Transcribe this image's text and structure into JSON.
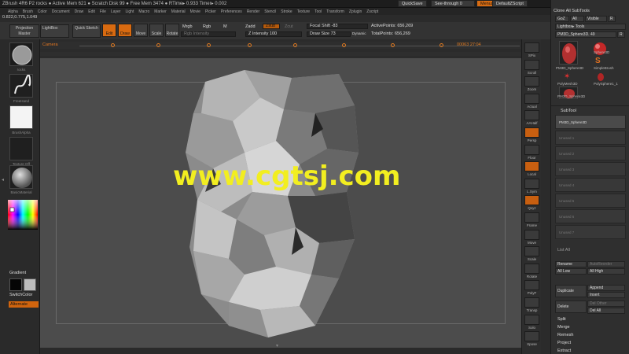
{
  "titlebar": {
    "text": "ZBrush 4R6 P2    rocks   ● Active Mem 621  ● Scratch Disk 99  ● Free Mem 3474  ● RTime▸ 0.933  Timer▸ 0.002",
    "quicksave": "QuickSave",
    "see_through": "See-through   0",
    "menus": "Menus",
    "script": "DefaultZScript"
  },
  "menubar": {
    "items": [
      "Alpha",
      "Brush",
      "Color",
      "Document",
      "Draw",
      "Edit",
      "File",
      "Layer",
      "Light",
      "Macro",
      "Marker",
      "Material",
      "Movie",
      "Picker",
      "Preferences",
      "Render",
      "Stencil",
      "Stroke",
      "Texture",
      "Tool",
      "Transform",
      "Zplugin",
      "Zscript"
    ]
  },
  "coords": "0.822,0.775,1.049",
  "shelf": {
    "projection_master": "Projection Master",
    "lightbox": "LightBox",
    "quick_sketch": "Quick Sketch",
    "edit": "Edit",
    "draw": "Draw",
    "move": "Move",
    "scale": "Scale",
    "rotate": "Rotate",
    "mrgb": "Mrgb",
    "rgb": "Rgb",
    "m": "M",
    "rgb_intensity": "Rgb Intensity",
    "zadd": "Zadd",
    "zsub": "Zsub",
    "zcut": "Zcut",
    "z_intensity": "Z Intensity 100",
    "focal_shift": "Focal Shift -83",
    "draw_size": "Draw Size 73",
    "dynamic": "Dynamic",
    "active_points": "ActivePoints: 656,269",
    "total_points": "TotalPoints: 656,269"
  },
  "camera": {
    "label": "Camera",
    "readout": "00063  27:04"
  },
  "left": {
    "brush_label": "rocks",
    "stroke_label": "FreeHand",
    "alpha_label": "BrushAlpha",
    "texture_label": "Texture Off",
    "material_label": "BasicMaterial",
    "gradient": "Gradient",
    "switch_color": "SwitchColor",
    "alternate": "Alternate"
  },
  "rightstrip": {
    "labels": [
      "SPix",
      "Scroll",
      "Zoom",
      "Actual",
      "AAHalf",
      "Persp",
      "Floor",
      "Local",
      "L.Sym",
      "Qxyz",
      "Frame",
      "Move",
      "Scale",
      "Rotate",
      "PolyF",
      "Transp",
      "Solo",
      "Xpose"
    ]
  },
  "toolpanel": {
    "header": "Clone  All  SubTools",
    "goz": "GoZ",
    "all": "All",
    "visible": "Visible",
    "r": "R",
    "lightbox_tools": "Lightbox▸ Tools",
    "current_tool": "PM3D_Sphere3D. 49",
    "r2": "R",
    "thumbs": [
      "PM3D_Sphere3D",
      "Sphere3D",
      "SimpleBrush",
      "PolyMesh3D",
      "PolySphere1_1",
      "PM3D_Sphere3D"
    ],
    "subtool_title": "SubTool",
    "subtool_active": "PM3D_Sphere3D",
    "subtool_slots": [
      "Unused 1",
      "Unused 2",
      "Unused 3",
      "Unused 4",
      "Unused 5",
      "Unused 6",
      "Unused 7"
    ],
    "list_all": "List All",
    "rename": "Rename",
    "auto_reorder": "AutoReorder",
    "all_low": "All Low",
    "all_high": "All High",
    "duplicate": "Duplicate",
    "append": "Append",
    "insert": "Insert",
    "delete": "Delete",
    "del_other": "Del Other",
    "del_all": "Del All",
    "split": "Split",
    "merge": "Merge",
    "remesh": "Remesh",
    "project": "Project",
    "extract": "Extract"
  },
  "watermark": "www.cgtsj.com",
  "colors": {
    "accent": "#d66b12",
    "watermark": "#f2ee20"
  }
}
